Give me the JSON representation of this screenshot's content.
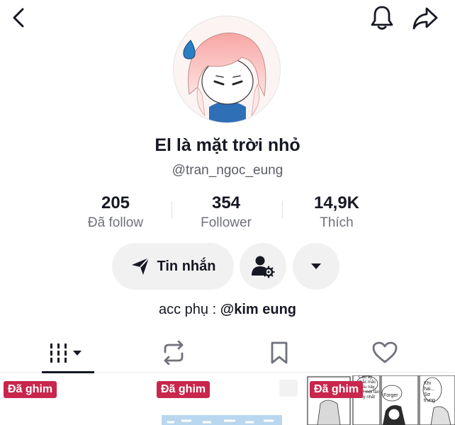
{
  "header": {
    "back_icon": "chevron-left-icon",
    "bell_icon": "bell-icon",
    "share_icon": "share-arrow-icon"
  },
  "profile": {
    "display_name": "El là mặt trời nhỏ",
    "username": "@tran_ngoc_eung",
    "avatar": "anime-girl-avatar"
  },
  "stats": [
    {
      "value": "205",
      "label": "Đã follow"
    },
    {
      "value": "354",
      "label": "Follower"
    },
    {
      "value": "14,9K",
      "label": "Thích"
    }
  ],
  "actions": {
    "message_label": "Tin nhắn",
    "message_icon": "send-icon",
    "suggest_icon": "user-settings-icon",
    "more_icon": "caret-down-icon"
  },
  "bio": {
    "prefix": "acc phụ : ",
    "mention": "@kim eung"
  },
  "tabs": [
    {
      "icon": "grid-bars-icon",
      "active": true
    },
    {
      "icon": "repost-icon",
      "active": false
    },
    {
      "icon": "bookmark-icon",
      "active": false
    },
    {
      "icon": "heart-outline-icon",
      "active": false
    }
  ],
  "videos": [
    {
      "pin_label": "Đã ghim"
    },
    {
      "pin_label": "Đã ghim"
    },
    {
      "pin_label": "Đã ghim",
      "manga_texts": [
        "Cậu ấy thắc mắc điều này, chỉ một lần duy nhất",
        "Forger",
        "Khi hai... Sơ trung"
      ]
    }
  ],
  "colors": {
    "pin_badge": "#c8264c",
    "button_bg": "#f1f1f2",
    "text_primary": "#161823",
    "text_secondary": "#70727b"
  }
}
